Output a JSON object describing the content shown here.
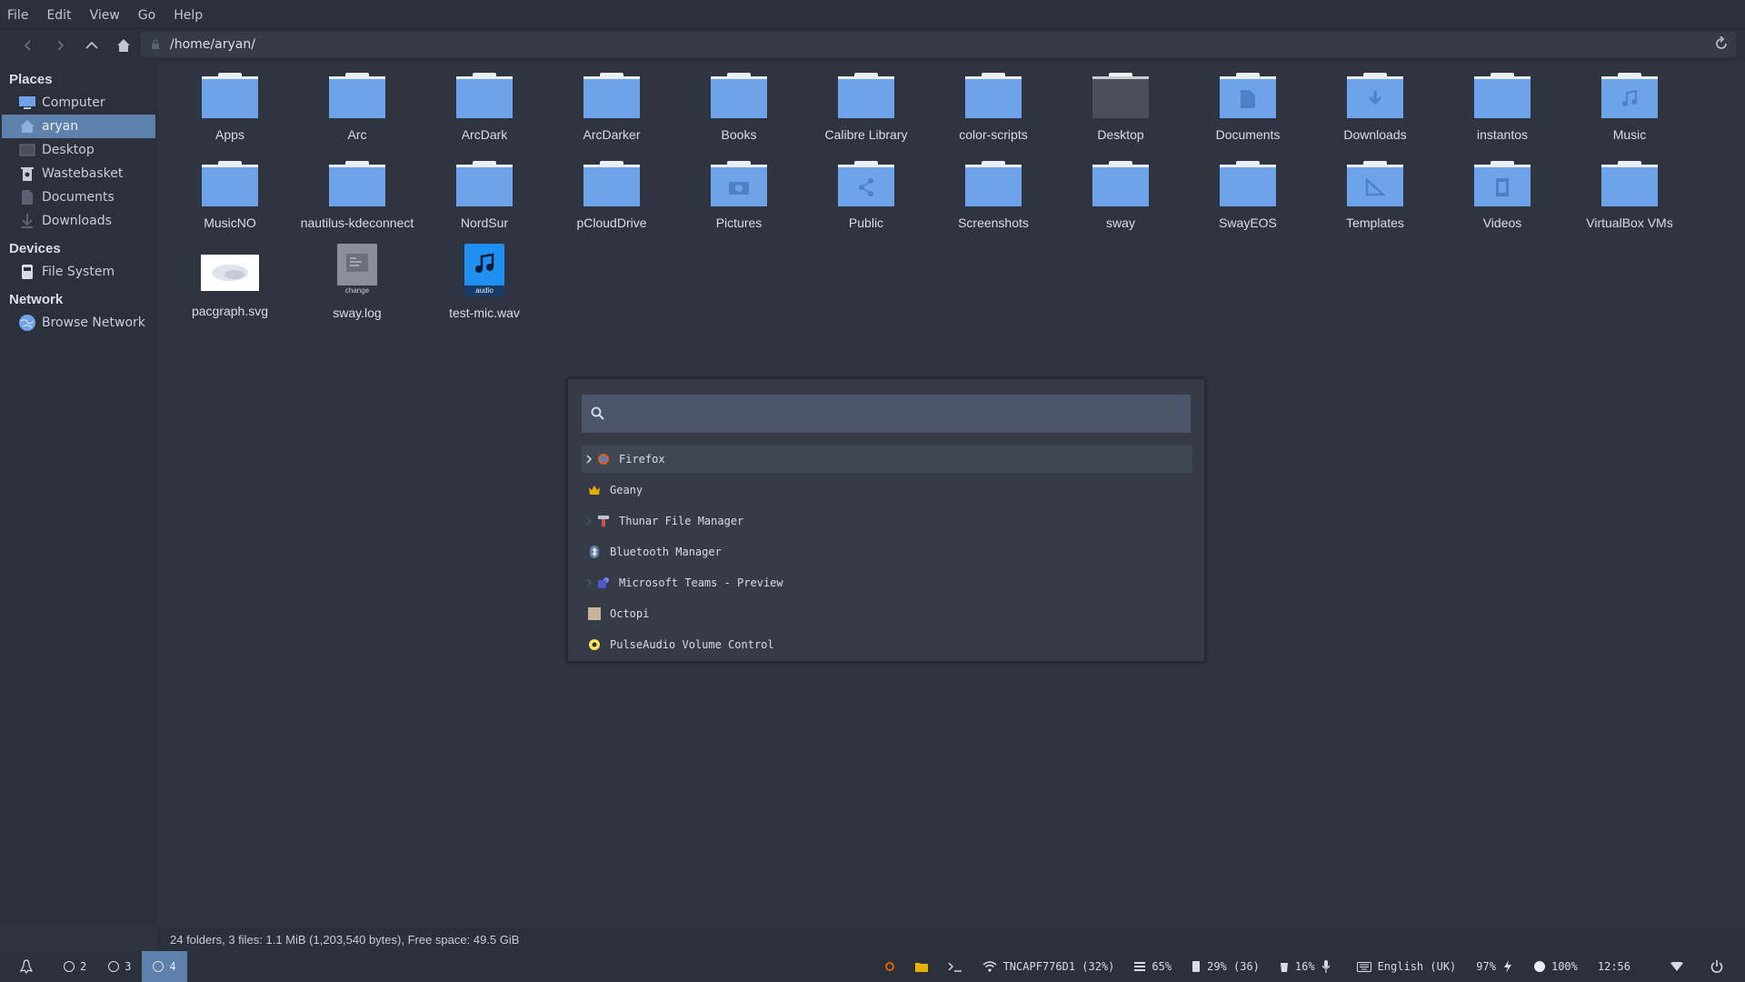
{
  "menubar": {
    "items": [
      "File",
      "Edit",
      "View",
      "Go",
      "Help"
    ]
  },
  "toolbar": {
    "path": "/home/aryan/"
  },
  "sidebar": {
    "places_header": "Places",
    "places": [
      "Computer",
      "aryan",
      "Desktop",
      "Wastebasket",
      "Documents",
      "Downloads"
    ],
    "devices_header": "Devices",
    "devices": [
      "File System"
    ],
    "network_header": "Network",
    "network": [
      "Browse Network"
    ]
  },
  "files": [
    "Apps",
    "Arc",
    "ArcDark",
    "ArcDarker",
    "Books",
    "Calibre Library",
    "color-scripts",
    "Desktop",
    "Documents",
    "Downloads",
    "instantos",
    "Music",
    "MusicNO",
    "nautilus-kdeconnect",
    "NordSur",
    "pCloudDrive",
    "Pictures",
    "Public",
    "Screenshots",
    "sway",
    "SwayEOS",
    "Templates",
    "Videos",
    "VirtualBox VMs",
    "pacgraph.svg",
    "sway.log",
    "test-mic.wav"
  ],
  "file_badges": {
    "log": "change",
    "audio": "audio"
  },
  "status": "24 folders, 3 files: 1.1 MiB (1,203,540 bytes), Free space: 49.5 GiB",
  "launcher": {
    "search_value": "",
    "items": [
      "Firefox",
      "Geany",
      "Thunar File Manager",
      "Bluetooth Manager",
      "Microsoft Teams - Preview",
      "Octopi",
      "PulseAudio Volume Control"
    ]
  },
  "taskbar": {
    "workspaces": [
      "2",
      "3",
      "4"
    ],
    "wifi": "TNCAPF776D1 (32%)",
    "memory": "65%",
    "battery_storage": "29% (36)",
    "cpu": "16%",
    "keyboard": "English (UK)",
    "brightness": "97%",
    "volume": "100%",
    "clock": "12:56"
  },
  "colors": {
    "accent": "#5e81ac",
    "folder": "#6ea2e9",
    "background": "#2e3440"
  }
}
